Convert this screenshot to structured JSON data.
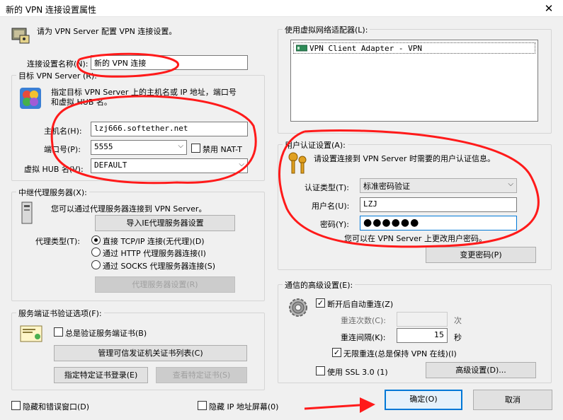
{
  "window": {
    "title": "新的 VPN 连接设置属性",
    "close_glyph": "✕"
  },
  "intro": {
    "text": "请为 VPN Server 配置 VPN 连接设置。"
  },
  "connection": {
    "label": "连接设置名称(N):",
    "value": "新的 VPN 连接"
  },
  "target": {
    "group_title": "目标 VPN Server (R):",
    "desc_line1": "指定目标 VPN Server 上的主机名或 IP 地址，端口号",
    "desc_line2": "和虚拟 HUB 名。",
    "host_label": "主机名(H):",
    "host_value": "lzj666.softether.net",
    "port_label": "端口号(P):",
    "port_value": "5555",
    "nat_label": "禁用 NAT-T",
    "hub_label": "虚拟 HUB 名(V):",
    "hub_value": "DEFAULT"
  },
  "proxy": {
    "group_title": "中继代理服务器(X):",
    "desc": "您可以通过代理服务器连接到 VPN Server。",
    "import_button": "导入IE代理服务器设置",
    "type_label": "代理类型(T):",
    "opt_direct": "直接 TCP/IP 连接(无代理)(D)",
    "opt_http": "通过 HTTP 代理服务器连接(I)",
    "opt_socks": "通过 SOCKS 代理服务器连接(S)",
    "settings_button": "代理服务器设置(R)"
  },
  "cert": {
    "group_title": "服务端证书验证选项(F):",
    "always_verify": "总是验证服务端证书(B)",
    "manage_button": "管理可信发证机关证书列表(C)",
    "specify_button": "指定特定证书登录(E)",
    "view_button": "查看特定证书(S)"
  },
  "adapter": {
    "group_title": "使用虚拟网络适配器(L):",
    "items": [
      "VPN Client Adapter - VPN"
    ]
  },
  "auth": {
    "group_title": "用户认证设置(A):",
    "desc": "请设置连接到 VPN Server 时需要的用户认证信息。",
    "type_label": "认证类型(T):",
    "type_value": "标准密码验证",
    "user_label": "用户名(U):",
    "user_value": "LZJ",
    "pass_label": "密码(Y):",
    "pass_value": "●●●●●●",
    "note": "您可以在 VPN Server 上更改用户密码。",
    "change_button": "变更密码(P)"
  },
  "advanced": {
    "group_title": "通信的高级设置(E):",
    "auto_reconnect": "断开后自动重连(Z)",
    "retry_label": "重连次数(C):",
    "retry_unit": "次",
    "interval_label": "重连间隔(K):",
    "interval_value": "15",
    "interval_unit": "秒",
    "infinite": "无限重连(总是保持 VPN 在线)(I)",
    "ssl3": "使用 SSL 3.0 (1)",
    "advanced_button": "高级设置(D)..."
  },
  "bottom": {
    "hide_errors": "隐藏和错误窗口(D)",
    "hide_ip": "隐藏 IP 地址屏幕(0)",
    "ok": "确定(O)",
    "cancel": "取消"
  },
  "colors": {
    "annotation_red": "#ff1a1a",
    "accent": "#0078d7"
  }
}
